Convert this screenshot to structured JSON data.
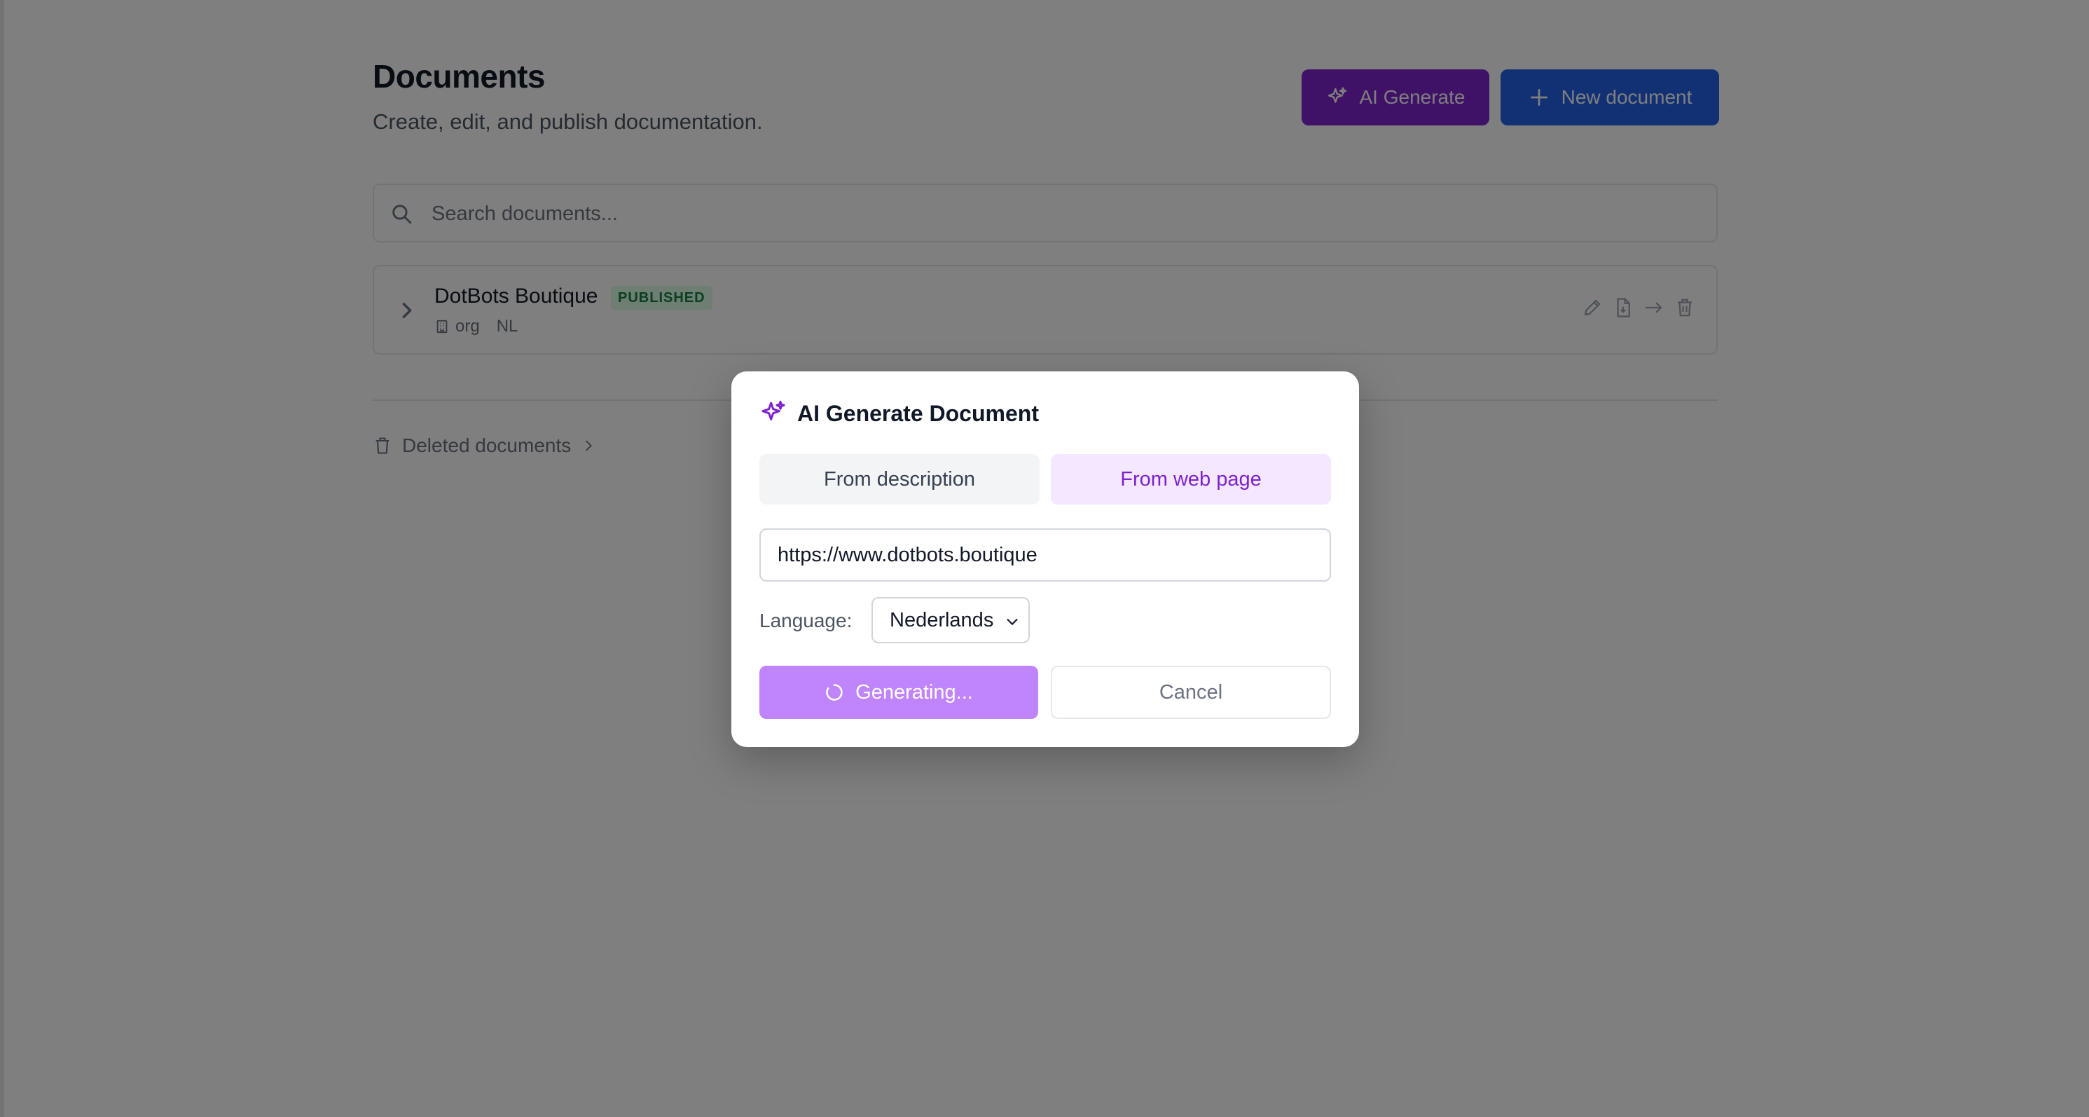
{
  "header": {
    "title": "Documents",
    "subtitle": "Create, edit, and publish documentation.",
    "ai_generate_label": "AI Generate",
    "new_document_label": "New document"
  },
  "search": {
    "placeholder": "Search documents...",
    "value": ""
  },
  "documents": [
    {
      "title": "DotBots Boutique",
      "status": "PUBLISHED",
      "scope": "org",
      "language": "NL",
      "icons": [
        "chevron-right-icon",
        "building-icon",
        "pencil-icon",
        "file-pdf-icon",
        "arrow-right-icon",
        "trash-icon"
      ]
    }
  ],
  "deleted": {
    "label": "Deleted documents"
  },
  "modal": {
    "title": "AI Generate Document",
    "tabs": [
      {
        "label": "From description",
        "active": false
      },
      {
        "label": "From web page",
        "active": true
      }
    ],
    "url_value": "https://www.dotbots.boutique",
    "language_label": "Language:",
    "language_value": "Nederlands",
    "generate_label": "Generating...",
    "cancel_label": "Cancel"
  },
  "colors": {
    "purple": "#7e22ce",
    "blue": "#2563eb",
    "badge_green": "#15803d",
    "generating_purple": "#c084fc"
  }
}
